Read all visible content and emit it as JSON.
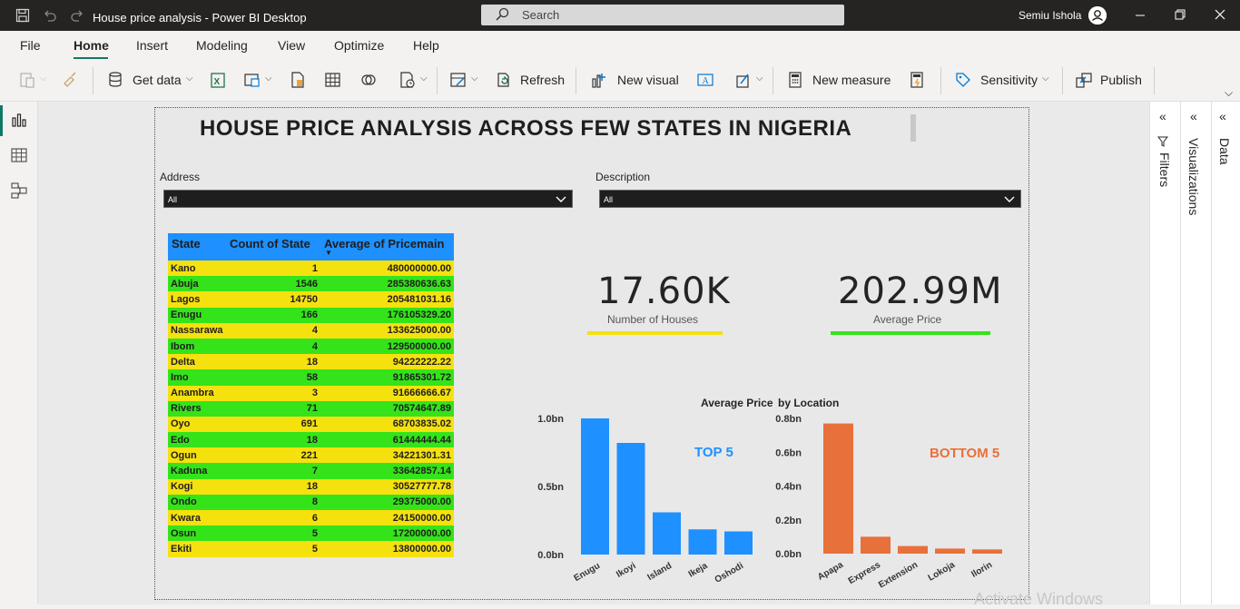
{
  "window": {
    "title": "House price analysis - Power BI Desktop",
    "search_placeholder": "Search",
    "user_name": "Semiu Ishola"
  },
  "menu": {
    "items": [
      "File",
      "Home",
      "Insert",
      "Modeling",
      "View",
      "Optimize",
      "Help"
    ],
    "active": "Home"
  },
  "ribbon": {
    "get_data": "Get data",
    "refresh": "Refresh",
    "new_visual": "New visual",
    "new_measure": "New measure",
    "sensitivity": "Sensitivity",
    "publish": "Publish"
  },
  "panes": {
    "filters": "Filters",
    "visualizations": "Visualizations",
    "data": "Data"
  },
  "report": {
    "title": "HOUSE PRICE ANALYSIS ACROSS FEW STATES IN NIGERIA",
    "slicers": [
      {
        "label": "Address",
        "value": "All"
      },
      {
        "label": "Description",
        "value": "All"
      }
    ],
    "table": {
      "headers": [
        "State",
        "Count of State",
        "Average of Pricemain"
      ],
      "rows": [
        [
          "Kano",
          "1",
          "480000000.00"
        ],
        [
          "Abuja",
          "1546",
          "285380636.63"
        ],
        [
          "Lagos",
          "14750",
          "205481031.16"
        ],
        [
          "Enugu",
          "166",
          "176105329.20"
        ],
        [
          "Nassarawa",
          "4",
          "133625000.00"
        ],
        [
          "Ibom",
          "4",
          "129500000.00"
        ],
        [
          "Delta",
          "18",
          "94222222.22"
        ],
        [
          "Imo",
          "58",
          "91865301.72"
        ],
        [
          "Anambra",
          "3",
          "91666666.67"
        ],
        [
          "Rivers",
          "71",
          "70574647.89"
        ],
        [
          "Oyo",
          "691",
          "68703835.02"
        ],
        [
          "Edo",
          "18",
          "61444444.44"
        ],
        [
          "Ogun",
          "221",
          "34221301.31"
        ],
        [
          "Kaduna",
          "7",
          "33642857.14"
        ],
        [
          "Kogi",
          "18",
          "30527777.78"
        ],
        [
          "Ondo",
          "8",
          "29375000.00"
        ],
        [
          "Kwara",
          "6",
          "24150000.00"
        ],
        [
          "Osun",
          "5",
          "17200000.00"
        ],
        [
          "Ekiti",
          "5",
          "13800000.00"
        ]
      ]
    },
    "cards": [
      {
        "value": "17.60K",
        "label": "Number of Houses",
        "color": "#f5e10e"
      },
      {
        "value": "202.99M",
        "label": "Average Price",
        "color": "#35e31a"
      }
    ],
    "chart_title_left": "Average Price",
    "chart_title_right": "by Location",
    "watermark": "Activate Windows"
  },
  "chart_data": [
    {
      "type": "bar",
      "label": "TOP 5",
      "label_color": "#1e90ff",
      "color": "#1e90ff",
      "categories": [
        "Enugu",
        "Ikoyi",
        "Island",
        "Ikeja",
        "Oshodi"
      ],
      "values": [
        1.0,
        0.82,
        0.31,
        0.185,
        0.17
      ],
      "ylim": [
        0,
        1.0
      ],
      "yticks": [
        "0.0bn",
        "0.5bn",
        "1.0bn"
      ]
    },
    {
      "type": "bar",
      "label": "BOTTOM 5",
      "label_color": "#e8703a",
      "color": "#e8703a",
      "categories": [
        "Apapa",
        "Express",
        "Extension",
        "Lokoja",
        "Ilorin"
      ],
      "values": [
        0.77,
        0.1,
        0.045,
        0.03,
        0.025
      ],
      "ylim": [
        0,
        0.8
      ],
      "yticks": [
        "0.0bn",
        "0.2bn",
        "0.4bn",
        "0.6bn",
        "0.8bn"
      ]
    }
  ]
}
